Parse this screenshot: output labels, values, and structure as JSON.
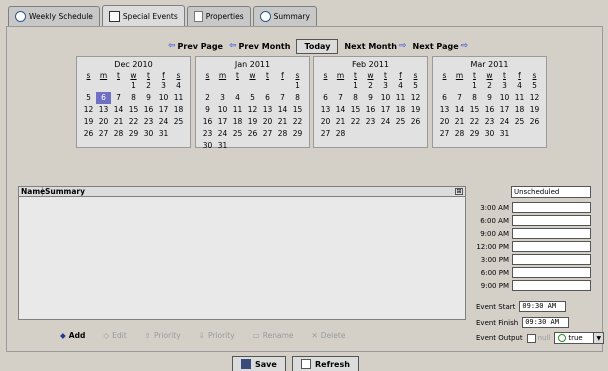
{
  "tabs": [
    {
      "label": "Weekly Schedule",
      "icon": "clock-icon",
      "active": false
    },
    {
      "label": "Special Events",
      "icon": "calendar-icon",
      "active": true
    },
    {
      "label": "Properties",
      "icon": "document-icon",
      "active": false
    },
    {
      "label": "Summary",
      "icon": "clock-icon",
      "active": false
    }
  ],
  "nav": {
    "prev_page": "Prev Page",
    "prev_month": "Prev Month",
    "today": "Today",
    "next_month": "Next Month",
    "next_page": "Next Page"
  },
  "days": [
    "s",
    "m",
    "t",
    "w",
    "t",
    "f",
    "s"
  ],
  "calendars": [
    {
      "title": "Dec 2010",
      "blanks": 3,
      "days": 31,
      "selected": 6
    },
    {
      "title": "Jan 2011",
      "blanks": 6,
      "days": 31,
      "selected": null
    },
    {
      "title": "Feb 2011",
      "blanks": 2,
      "days": 28,
      "selected": null
    },
    {
      "title": "Mar 2011",
      "blanks": 2,
      "days": 31,
      "selected": null
    }
  ],
  "table": {
    "columns": [
      "Name",
      "Summary"
    ],
    "corner_icon": "⊞"
  },
  "actions": [
    {
      "label": "Add",
      "icon": "add-icon",
      "glyph": "◆",
      "enabled": true
    },
    {
      "label": "Edit",
      "icon": "edit-icon",
      "glyph": "◇",
      "enabled": false
    },
    {
      "label": "Priority",
      "icon": "priority-up-icon",
      "glyph": "⇧",
      "enabled": false
    },
    {
      "label": "Priority",
      "icon": "priority-down-icon",
      "glyph": "⇩",
      "enabled": false
    },
    {
      "label": "Rename",
      "icon": "rename-icon",
      "glyph": "▭",
      "enabled": false
    },
    {
      "label": "Delete",
      "icon": "delete-icon",
      "glyph": "✕",
      "enabled": false
    }
  ],
  "schedule": {
    "header": "Unscheduled",
    "times": [
      "3:00 AM",
      "6:00 AM",
      "9:00 AM",
      "12:00 PM",
      "3:00 PM",
      "6:00 PM",
      "9:00 PM"
    ]
  },
  "event": {
    "start_label": "Event Start",
    "start_value": "09:30 AM",
    "finish_label": "Event Finish",
    "finish_value": "09:30 AM",
    "output_label": "Event Output",
    "null_label": "null",
    "output_value": "true"
  },
  "buttons": {
    "save": "Save",
    "refresh": "Refresh"
  },
  "colors": {
    "selected_day": "#6f6fc3",
    "nav_arrow": "#5566dd"
  }
}
